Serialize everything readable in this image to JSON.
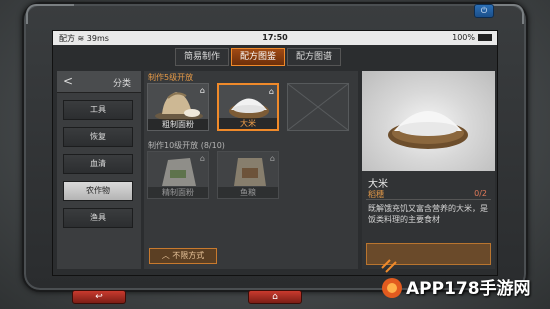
{
  "status": {
    "carrier": "配方",
    "signal": "39ms",
    "time": "17:50",
    "battery": "100%"
  },
  "tabs": [
    {
      "label": "简易制作",
      "active": false
    },
    {
      "label": "配方图鉴",
      "active": true
    },
    {
      "label": "配方图谱",
      "active": false
    }
  ],
  "sidebar": {
    "title": "分类",
    "items": [
      {
        "label": "工具",
        "selected": false
      },
      {
        "label": "恢复",
        "selected": false
      },
      {
        "label": "血清",
        "selected": false
      },
      {
        "label": "农作物",
        "selected": true
      },
      {
        "label": "渔具",
        "selected": false
      }
    ]
  },
  "recipes": {
    "section1": "制作5级开放",
    "section2": "制作10级开放 (8/10)",
    "cards": [
      {
        "label": "粗制面粉"
      },
      {
        "label": "大米"
      },
      {
        "label": "精制面粉"
      },
      {
        "label": "鱼粮"
      }
    ],
    "filter_label": "不限方式"
  },
  "detail": {
    "name": "大米",
    "ingredient": "稻穗",
    "ingredient_count": "0/2",
    "description": "既解饿充饥又富含营养的大米，是饭类料理的主要食材"
  },
  "watermark": "APP178手游网",
  "colors": {
    "accent": "#f08a2a",
    "frame": "#2a2c2e"
  }
}
